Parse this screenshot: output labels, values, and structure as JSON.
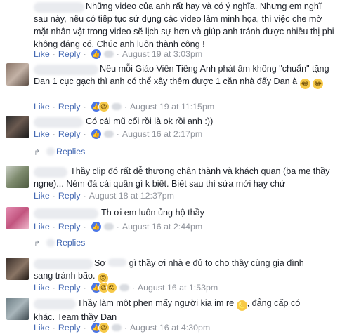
{
  "comments": [
    {
      "text_lines": [
        "Những video của anh rất hay và có ý nghĩa. Nhưng em nghĩ",
        "sau này, nếu có tiếp tục sử dụng các video làm minh họa, thì việc che mờ",
        "mặt nhân vật trong video sẽ lịch sự hơn và giúp anh tránh được nhiều thị phi",
        "không đáng có. Chúc anh luôn thành công !"
      ],
      "actions": {
        "like": "Like",
        "reply": "Reply"
      },
      "reaction_icons": [
        "like-icon"
      ],
      "time": "August 19 at 3:03pm"
    },
    {
      "text_lines": [
        "Nếu mỗi Giáo Viên Tiếng Anh phát âm không \"chuẩn\" tặng",
        "Dan 1 cục gạch thì anh có thể xây thêm được 1 căn nhà đấy Dan à"
      ],
      "emojis": [
        "😂",
        "😂"
      ],
      "actions": {
        "like": "Like",
        "reply": "Reply"
      },
      "reaction_icons": [
        "like-icon",
        "haha-icon"
      ],
      "time": "August 19 at 11:15pm"
    },
    {
      "text_lines": [
        "Có cái mũ cối rồi là ok rồi anh :))"
      ],
      "actions": {
        "like": "Like",
        "reply": "Reply"
      },
      "reaction_icons": [
        "like-icon"
      ],
      "time": "August 16 at 2:17pm",
      "replies_label": "Replies"
    },
    {
      "text_lines": [
        "Thầy clip đó rất dễ thương chân thành và khách quan (ba mẹ thầy",
        "ngne)... Ném đá cái quần gì k biết. Biết sau thì sửa mới hay chứ"
      ],
      "actions": {
        "like": "Like",
        "reply": "Reply"
      },
      "time": "August 18 at 12:37pm"
    },
    {
      "text_lines": [
        "Th ơi em luôn ủng hộ thầy"
      ],
      "actions": {
        "like": "Like",
        "reply": "Reply"
      },
      "reaction_icons": [
        "like-icon"
      ],
      "time": "August 16 at 2:44pm",
      "replies_label": "Replies"
    },
    {
      "text_lines": [
        "gì thầy ơi nhà e đủ to cho thầy cùng gia đình",
        "sang tránh bão."
      ],
      "prefix": "Sợ",
      "actions": {
        "like": "Like",
        "reply": "Reply"
      },
      "reaction_icons": [
        "like-icon",
        "haha-icon",
        "wow-icon"
      ],
      "time": "August 16 at 1:53pm"
    },
    {
      "text_lines": [
        "Thầy làm một phen mấy người kia im re",
        "khác. Team thầy Dan"
      ],
      "text_tail": ", đẳng cấp có",
      "actions": {
        "like": "Like",
        "reply": "Reply"
      },
      "reaction_icons": [
        "like-icon",
        "haha-icon"
      ],
      "time": "August 16 at 4:30pm"
    }
  ],
  "colors": {
    "link": "#4267b2",
    "meta": "#90949c",
    "text": "#1d2129",
    "like_reaction": "#4a76e8",
    "haha_reaction": "#f7c948"
  }
}
